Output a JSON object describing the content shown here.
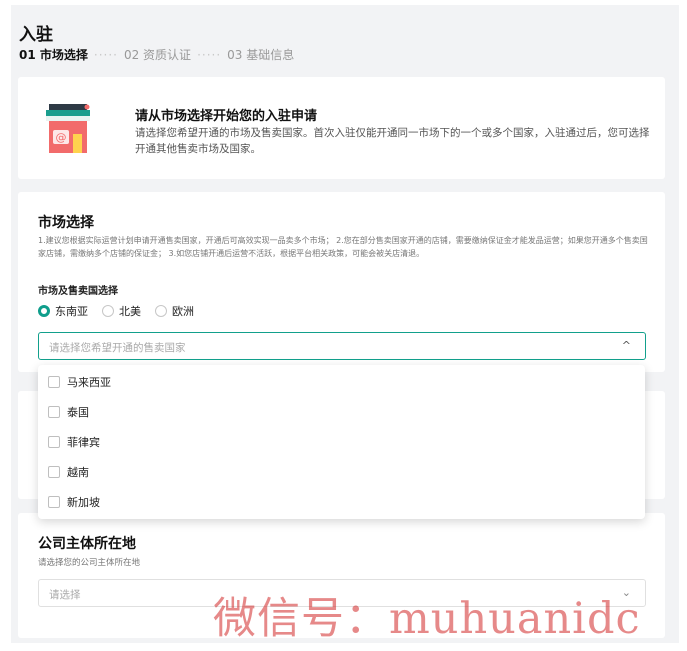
{
  "page": {
    "title": "入驻",
    "steps": [
      {
        "label": "01 市场选择"
      },
      {
        "label": "02 资质认证"
      },
      {
        "label": "03 基础信息"
      }
    ],
    "step_separator": "·····"
  },
  "intro": {
    "icon": "shop-icon",
    "title": "请从市场选择开始您的入驻申请",
    "description": "请选择您希望开通的市场及售卖国家。首次入驻仅能开通同一市场下的一个或多个国家，入驻通过后，您可选择开通其他售卖市场及国家。"
  },
  "market": {
    "title": "市场选择",
    "note": "1.建议您根据实际运营计划申请开通售卖国家，开通后可高效实现一品卖多个市场； 2.您在部分售卖国家开通的店铺，需要缴纳保证金才能发品运营；如果您开通多个售卖国家店铺，需缴纳多个店铺的保证金； 3.如您店铺开通后运营不活跃，根据平台相关政策，可能会被关店清退。",
    "field_label": "市场及售卖国选择",
    "regions": [
      {
        "label": "东南亚",
        "selected": true
      },
      {
        "label": "北美",
        "selected": false
      },
      {
        "label": "欧洲",
        "selected": false
      }
    ],
    "country_placeholder": "请选择您希望开通的售卖国家",
    "caret": "^"
  },
  "dropdown": {
    "options": [
      {
        "label": "马来西亚",
        "checked": false
      },
      {
        "label": "泰国",
        "checked": false
      },
      {
        "label": "菲律宾",
        "checked": false
      },
      {
        "label": "越南",
        "checked": false
      },
      {
        "label": "新加坡",
        "checked": false
      }
    ]
  },
  "company": {
    "title": "公司主体所在地",
    "subtitle": "请选择您的公司主体所在地",
    "placeholder": "请选择",
    "caret": "⌄"
  },
  "watermark": "微信号：muhuanidc",
  "colors": {
    "accent": "#0f9e8c",
    "background": "#f2f3f5",
    "shop_roof": "#1a9e8e",
    "shop_body": "#f26b6b"
  }
}
